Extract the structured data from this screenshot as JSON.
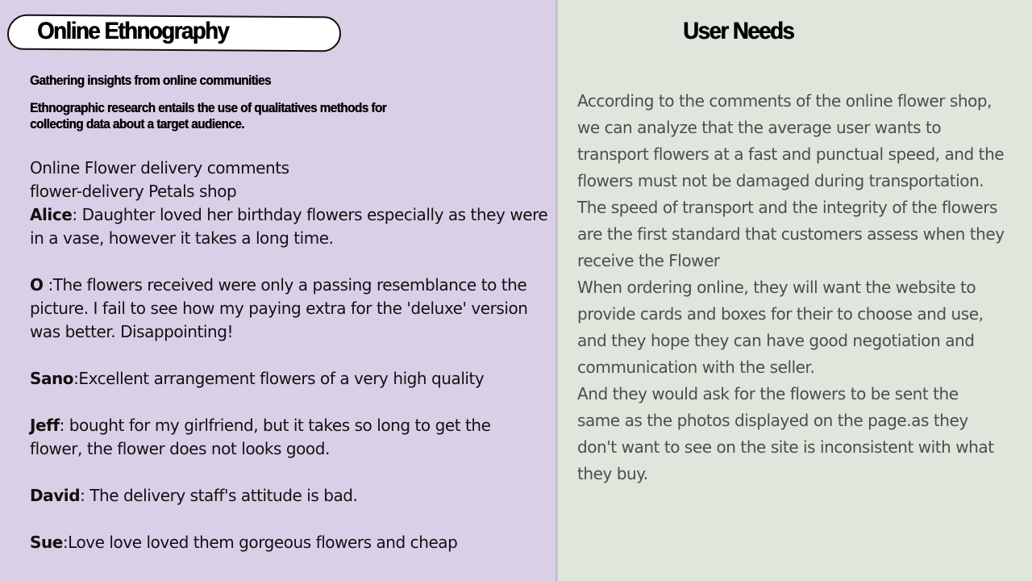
{
  "left": {
    "title": "Online Ethnography",
    "subtitle1": "Gathering insights from online communities",
    "subtitle2_line1": "Ethnographic research entails the use of qualitatives methods for",
    "subtitle2_line2": "collecting data about a target audience.",
    "source_line1": "Online Flower delivery comments",
    "source_line2": "flower-delivery Petals shop",
    "comments": [
      {
        "author": "Alice",
        "text_line1": ": Daughter loved her birthday flowers especially as they were",
        "text_line2": "in a vase, however it takes a long time."
      },
      {
        "author": "O",
        "text_line1": " :The flowers received were only a passing resemblance to the",
        "text_line2": "picture. I fail to see how my paying extra for the 'deluxe' version",
        "text_line3": "was better. Disappointing!"
      },
      {
        "author": "Sano",
        "text_line1": ":Excellent arrangement flowers of a very high quality"
      },
      {
        "author": "Jeff",
        "text_line1": ": bought for my girlfriend, but it takes so long to get the",
        "text_line2": "flower, the flower does not looks good."
      },
      {
        "author": "David",
        "text_line1": ": The delivery staff's attitude is bad."
      },
      {
        "author": "Sue",
        "text_line1": ":Love love loved them gorgeous flowers and cheap"
      }
    ]
  },
  "right": {
    "title": "User Needs",
    "lines": [
      "According to the comments of the online flower shop,",
      "we can analyze that the average user wants to",
      "transport flowers at a fast and punctual speed, and the",
      "flowers must not be damaged during transportation.",
      "The speed of transport and the integrity of the flowers",
      "are the first standard that customers assess when they",
      "receive the Flower",
      "When ordering online, they will want the website to",
      "provide cards and boxes for their to choose and use,",
      "and they hope they can have good negotiation and",
      "communication with the seller.",
      "And they would ask for the flowers to be sent the",
      "same as the photos displayed on the page.as they",
      "don't want to see on the site is inconsistent with what",
      "they buy."
    ]
  },
  "colors": {
    "left_background": "#d9d0e8",
    "right_background": "#dfe7dc",
    "needs_text": "#4d4d4d"
  }
}
